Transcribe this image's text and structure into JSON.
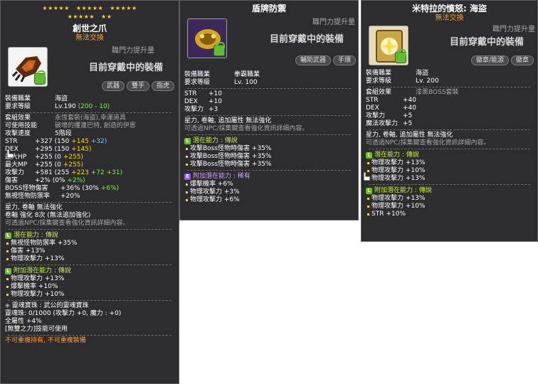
{
  "panel1": {
    "stars_row1": [
      "★★★★★",
      "★★★★★",
      "★★★★★"
    ],
    "stars_row2": [
      "★★★★★",
      "★★"
    ],
    "title": "創世之爪",
    "subtitle": "無法交換",
    "req_up": "職門力提升量",
    "equipped": "目前穿戴中的裝備",
    "tags": [
      "武器",
      "雙手",
      "指虎"
    ],
    "equip_job": {
      "k": "裝備職業",
      "v": "海盜"
    },
    "req_level": {
      "k": "要求等級",
      "v": "Lv.190",
      "extra": "(200 - 10)"
    },
    "set_effect": {
      "k": "套組效果",
      "v": "永恆套裝(海盜),幸運道具"
    },
    "skill": {
      "k": "可使用技能",
      "v": "破壞的攫連巴特, 創造的伊恩"
    },
    "atk_speed": {
      "k": "攻擊速度",
      "v": "5階段"
    },
    "stats": [
      {
        "k": "STR",
        "v": "+327",
        "p1": "(150 ",
        "p2": "+145",
        "p3": " +32)"
      },
      {
        "k": "DEX",
        "v": "+295",
        "p1": "(150 ",
        "p2": "+145)",
        "p3": ""
      },
      {
        "k": "最大HP",
        "v": "+255",
        "p1": "(0 ",
        "p2": "+255)",
        "p3": ""
      },
      {
        "k": "最大MP",
        "v": "+255",
        "p1": "(0 ",
        "p2": "+255)",
        "p3": ""
      },
      {
        "k": "攻擊力",
        "v": "+581",
        "p1": "(255 ",
        "p2": "+223",
        "p3": " +72 +31)"
      },
      {
        "k": "傷害",
        "v": "+2%",
        "p1": "(0% ",
        "p2": "+2%)",
        "p3": ""
      },
      {
        "k": "BOSS怪物傷害",
        "v": "+36%",
        "p1": "(30% ",
        "p2": "+6%)",
        "p3": ""
      },
      {
        "k": "無視怪物防禦率",
        "v": "+20%",
        "p1": "",
        "p2": "",
        "p3": ""
      }
    ],
    "star_force": "星力, 卷軸 無法強化",
    "scroll": "卷軸 強化 8次 (無法追加強化)",
    "npc_note": "可透過NPC/採集鍵查看強化資訊詳細內容。",
    "potential_title": "潛在能力 : 傳說",
    "potential": [
      "無視怪物防禦率 +35%",
      "傷害 +13%",
      "物理攻擊力 +13%"
    ],
    "add_potential_title": "附加潛在能力 : 傳說",
    "add_potential": [
      "物理攻擊力 +13%",
      "爆擊機率 +10%",
      "物理攻擊力 +10%"
    ],
    "soul_title": "靈魂寶珠 : 武公的靈魂寶珠",
    "soul_line": "靈魂珠:  0/1000 (攻擊力 +0, 魔力 : +0)",
    "all_stat": "全屬性 +4%",
    "skill_note": "[無雙之力]技能可使用",
    "footer": "不可重複持有, 不可重複裝備"
  },
  "panel2": {
    "title": "盾牌防禦",
    "req_up": "職門力提升量",
    "equipped": "目前穿戴中的裝備",
    "tags": [
      "輔助武器",
      "手環"
    ],
    "equip_job": {
      "k": "裝備職業",
      "v": "拳霸職業"
    },
    "req_level": {
      "k": "要求等級",
      "v": "Lv. 100"
    },
    "stats": [
      {
        "k": "STR",
        "v": "+10"
      },
      {
        "k": "DEX",
        "v": "+10"
      },
      {
        "k": "攻擊力",
        "v": "+3"
      }
    ],
    "star_force": "星力, 卷軸, 追加屬性 無法強化",
    "npc_note": "可透過NPC/採集鍵查看強化資訊詳細內容。",
    "potential_title": "潛在能力 : 傳說",
    "potential": [
      "攻擊Boss怪物時傷害 +35%",
      "攻擊Boss怪物時傷害 +35%",
      "攻擊Boss怪物時傷害 +35%"
    ],
    "add_potential_title": "附加潛在能力 : 稀有",
    "add_potential": [
      "爆擊機率 +6%",
      "物理攻擊力 +3%",
      "物理攻擊力 +6%"
    ]
  },
  "panel3": {
    "title": "米特拉的憤怒: 海盜",
    "subtitle": "無法交換",
    "req_up": "職門力提升量",
    "equipped": "目前穿戴中的裝備",
    "tags": [
      "徽章/能源",
      "徽章"
    ],
    "equip_job": {
      "k": "裝備職業",
      "v": "海盜"
    },
    "req_level": {
      "k": "要求等級",
      "v": "Lv. 200"
    },
    "set_effect": {
      "k": "套組效果",
      "v": "漆黑BOSS套裝"
    },
    "stats": [
      {
        "k": "STR",
        "v": "+40"
      },
      {
        "k": "DEX",
        "v": "+40"
      },
      {
        "k": "攻擊力",
        "v": "+5"
      },
      {
        "k": "魔法攻擊力",
        "v": "+5"
      }
    ],
    "star_force": "星力, 卷軸, 追加屬性 無法強化",
    "npc_note": "可透過NPC/採集鍵查看強化資訊詳細內容。",
    "potential_title": "潛在能力 : 傳說",
    "potential": [
      "物理攻擊力 +13%",
      "物理攻擊力 +10%",
      "物理攻擊力 +13%"
    ],
    "add_potential_title": "附加潛在能力 : 傳說",
    "add_potential": [
      "物理攻擊力 +13%",
      "物理攻擊力 +10%",
      "STR +10%"
    ]
  }
}
